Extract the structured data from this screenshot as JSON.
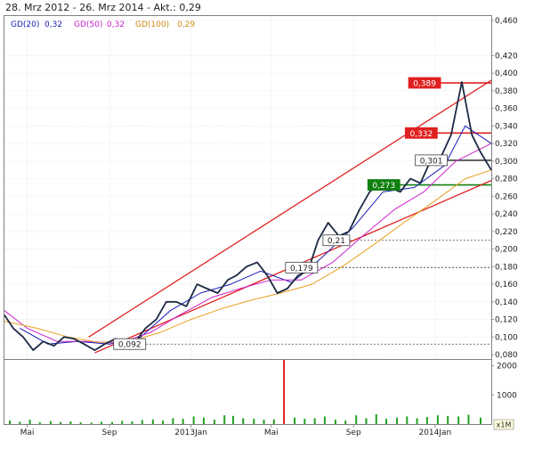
{
  "header": {
    "title": "28. Mrz 2012 - 26. Mrz 2014 - Akt.: 0,29"
  },
  "chart_data": {
    "type": "line",
    "title": "28. Mrz 2012 - 26. Mrz 2014 - Akt.: 0,29",
    "price_axis": {
      "ylim": [
        0.075,
        0.465
      ],
      "ticks": [
        0.08,
        0.1,
        0.12,
        0.14,
        0.16,
        0.18,
        0.2,
        0.22,
        0.24,
        0.26,
        0.28,
        0.3,
        0.32,
        0.34,
        0.36,
        0.38,
        0.4,
        0.42,
        0.46
      ],
      "tick_labels": [
        "0,080",
        "0,100",
        "0,120",
        "0,140",
        "0,160",
        "0,180",
        "0,200",
        "0,220",
        "0,240",
        "0,260",
        "0,280",
        "0,300",
        "0,320",
        "0,340",
        "0,360",
        "0,380",
        "0,400",
        "0,420",
        "0,460"
      ],
      "grid": true
    },
    "volume_axis": {
      "ylim": [
        0,
        2200
      ],
      "ticks": [
        1000,
        2000
      ],
      "tick_labels": [
        "1000",
        "2000"
      ],
      "unit_label": "x1M"
    },
    "x_axis": {
      "xlim": [
        "2012-03-28",
        "2014-03-26"
      ],
      "ticks": [
        "2012-05-01",
        "2012-09-01",
        "2013-01-01",
        "2013-05-01",
        "2013-09-01",
        "2014-01-01"
      ],
      "tick_labels": [
        "Mai",
        "Sep",
        "2013Jan",
        "Mai",
        "Sep",
        "2014Jan"
      ]
    },
    "legend": {
      "placement": "top-left",
      "entries": [
        {
          "label": "GD(20)",
          "value": "0,32",
          "color": "#1a1ab8"
        },
        {
          "label": "GD(50)",
          "value": "0,32",
          "color": "#cc22cc"
        },
        {
          "label": "GD(100)",
          "value": "0,29",
          "color": "#e8a020"
        }
      ]
    },
    "series": [
      {
        "name": "Kurs",
        "color": "#1c2a44",
        "x": [
          "2012-03-28",
          "2012-04-10",
          "2012-04-25",
          "2012-05-10",
          "2012-05-25",
          "2012-06-10",
          "2012-06-25",
          "2012-07-10",
          "2012-07-25",
          "2012-08-10",
          "2012-08-25",
          "2012-09-10",
          "2012-09-25",
          "2012-10-10",
          "2012-10-25",
          "2012-11-10",
          "2012-11-25",
          "2012-12-10",
          "2012-12-25",
          "2013-01-10",
          "2013-01-25",
          "2013-02-10",
          "2013-02-25",
          "2013-03-10",
          "2013-03-25",
          "2013-04-10",
          "2013-04-25",
          "2013-05-10",
          "2013-05-25",
          "2013-06-10",
          "2013-06-25",
          "2013-07-10",
          "2013-07-25",
          "2013-08-10",
          "2013-08-25",
          "2013-09-10",
          "2013-09-25",
          "2013-10-10",
          "2013-10-25",
          "2013-11-10",
          "2013-11-25",
          "2013-12-10",
          "2013-12-25",
          "2014-01-10",
          "2014-01-25",
          "2014-02-10",
          "2014-02-25",
          "2014-03-10",
          "2014-03-26"
        ],
        "values": [
          0.125,
          0.11,
          0.1,
          0.085,
          0.095,
          0.09,
          0.1,
          0.098,
          0.092,
          0.085,
          0.092,
          0.098,
          0.095,
          0.095,
          0.11,
          0.12,
          0.14,
          0.14,
          0.135,
          0.16,
          0.155,
          0.15,
          0.165,
          0.17,
          0.18,
          0.185,
          0.17,
          0.15,
          0.155,
          0.17,
          0.175,
          0.21,
          0.23,
          0.215,
          0.22,
          0.245,
          0.265,
          0.275,
          0.27,
          0.265,
          0.28,
          0.275,
          0.3,
          0.305,
          0.33,
          0.39,
          0.33,
          0.31,
          0.29
        ]
      },
      {
        "name": "GD(20)",
        "color": "#1a1ab8",
        "x": [
          "2012-04-20",
          "2012-06-01",
          "2012-07-15",
          "2012-09-01",
          "2012-10-15",
          "2012-12-01",
          "2013-01-15",
          "2013-03-01",
          "2013-04-15",
          "2013-06-01",
          "2013-07-15",
          "2013-09-01",
          "2013-10-15",
          "2013-12-01",
          "2014-01-15",
          "2014-02-15",
          "2014-03-26"
        ],
        "values": [
          0.11,
          0.092,
          0.095,
          0.092,
          0.098,
          0.13,
          0.15,
          0.16,
          0.175,
          0.162,
          0.19,
          0.225,
          0.265,
          0.27,
          0.295,
          0.34,
          0.32
        ]
      },
      {
        "name": "GD(50)",
        "color": "#cc22cc",
        "x": [
          "2012-03-28",
          "2012-05-01",
          "2012-06-15",
          "2012-08-01",
          "2012-09-15",
          "2012-11-01",
          "2012-12-15",
          "2013-02-01",
          "2013-03-15",
          "2013-05-01",
          "2013-06-15",
          "2013-08-01",
          "2013-09-15",
          "2013-11-01",
          "2013-12-15",
          "2014-02-01",
          "2014-03-26"
        ],
        "values": [
          0.13,
          0.11,
          0.095,
          0.095,
          0.093,
          0.105,
          0.125,
          0.145,
          0.155,
          0.165,
          0.165,
          0.185,
          0.215,
          0.245,
          0.265,
          0.3,
          0.32
        ]
      },
      {
        "name": "GD(100)",
        "color": "#e8a020",
        "x": [
          "2012-03-28",
          "2012-05-15",
          "2012-07-01",
          "2012-08-15",
          "2012-10-01",
          "2012-11-15",
          "2013-01-01",
          "2013-02-15",
          "2013-04-01",
          "2013-05-15",
          "2013-07-01",
          "2013-08-15",
          "2013-10-01",
          "2013-11-15",
          "2014-01-01",
          "2014-02-15",
          "2014-03-26"
        ],
        "values": [
          0.118,
          0.11,
          0.1,
          0.094,
          0.095,
          0.105,
          0.12,
          0.132,
          0.142,
          0.15,
          0.16,
          0.18,
          0.205,
          0.23,
          0.255,
          0.28,
          0.29
        ]
      }
    ],
    "channel_lines": [
      {
        "name": "upper-trend",
        "color": "#e02020",
        "x": [
          "2012-08-01",
          "2014-03-26"
        ],
        "values": [
          0.1,
          0.392
        ]
      },
      {
        "name": "lower-trend",
        "color": "#e02020",
        "x": [
          "2012-08-10",
          "2014-03-26"
        ],
        "values": [
          0.082,
          0.278
        ]
      }
    ],
    "hlines": [
      {
        "value": 0.092,
        "style": "dashed",
        "color": "#404040",
        "from": "2012-10-20"
      },
      {
        "value": 0.179,
        "style": "dashed",
        "color": "#404040",
        "from": "2013-06-01"
      },
      {
        "value": 0.21,
        "style": "dashed",
        "color": "#404040",
        "from": "2013-07-20"
      },
      {
        "value": 0.273,
        "style": "solid",
        "color": "#108010",
        "from": "2013-09-25"
      },
      {
        "value": 0.301,
        "style": "solid",
        "color": "#404040",
        "from": "2013-12-05"
      },
      {
        "value": 0.332,
        "style": "solid",
        "color": "#e02020",
        "from": "2013-11-20"
      },
      {
        "value": 0.389,
        "style": "solid",
        "color": "#e02020",
        "from": "2013-11-25"
      }
    ],
    "annotations": [
      {
        "text": "0,092",
        "value": 0.092,
        "x": "2012-09-10",
        "style": "white"
      },
      {
        "text": "0,179",
        "value": 0.179,
        "x": "2013-05-25",
        "style": "white"
      },
      {
        "text": "0,21",
        "value": 0.21,
        "x": "2013-07-20",
        "style": "white"
      },
      {
        "text": "0,273",
        "value": 0.273,
        "x": "2013-09-25",
        "style": "green"
      },
      {
        "text": "0,301",
        "value": 0.301,
        "x": "2013-12-05",
        "style": "white"
      },
      {
        "text": "0,332",
        "value": 0.332,
        "x": "2013-11-20",
        "style": "red"
      },
      {
        "text": "0,389",
        "value": 0.389,
        "x": "2013-11-25",
        "style": "red"
      }
    ],
    "volume": {
      "color": "#22a022",
      "x": [
        "2012-04-05",
        "2012-04-20",
        "2012-05-05",
        "2012-05-20",
        "2012-06-05",
        "2012-06-20",
        "2012-07-05",
        "2012-07-20",
        "2012-08-05",
        "2012-08-20",
        "2012-09-05",
        "2012-09-20",
        "2012-10-05",
        "2012-10-20",
        "2012-11-05",
        "2012-11-20",
        "2012-12-05",
        "2012-12-20",
        "2013-01-05",
        "2013-01-20",
        "2013-02-05",
        "2013-02-20",
        "2013-03-05",
        "2013-03-20",
        "2013-04-05",
        "2013-04-20",
        "2013-05-05",
        "2013-05-20",
        "2013-06-05",
        "2013-06-20",
        "2013-07-05",
        "2013-07-20",
        "2013-08-05",
        "2013-08-20",
        "2013-09-05",
        "2013-09-20",
        "2013-10-05",
        "2013-10-20",
        "2013-11-05",
        "2013-11-20",
        "2013-12-05",
        "2013-12-20",
        "2014-01-05",
        "2014-01-20",
        "2014-02-05",
        "2014-02-20",
        "2014-03-10"
      ],
      "values": [
        120,
        80,
        150,
        60,
        100,
        70,
        90,
        60,
        50,
        80,
        70,
        110,
        90,
        140,
        160,
        120,
        200,
        180,
        260,
        220,
        150,
        300,
        280,
        200,
        180,
        150,
        160,
        2200,
        220,
        180,
        200,
        260,
        150,
        120,
        300,
        200,
        340,
        180,
        220,
        260,
        200,
        240,
        300,
        280,
        260,
        320,
        220
      ]
    }
  }
}
